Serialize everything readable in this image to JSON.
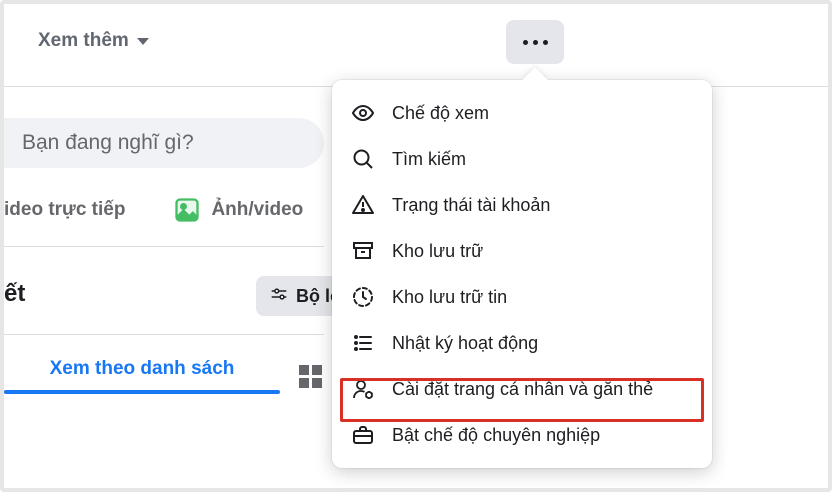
{
  "header": {
    "see_more_label": "Xem thêm"
  },
  "composer": {
    "placeholder": "Bạn đang nghĩ gì?"
  },
  "media_row": {
    "live_video": "ideo trực tiếp",
    "photo_video": "Ảnh/video"
  },
  "posts_section": {
    "title_fragment": "ết",
    "filter_label": "Bộ lọc"
  },
  "tabs": {
    "list_view": "Xem theo danh sách"
  },
  "dropdown": {
    "items": [
      {
        "label": "Chế độ xem"
      },
      {
        "label": "Tìm kiếm"
      },
      {
        "label": "Trạng thái tài khoản"
      },
      {
        "label": "Kho lưu trữ"
      },
      {
        "label": "Kho lưu trữ tin"
      },
      {
        "label": "Nhật ký hoạt động"
      },
      {
        "label": "Cài đặt trang cá nhân và gắn thẻ"
      },
      {
        "label": "Bật chế độ chuyên nghiệp"
      }
    ]
  }
}
